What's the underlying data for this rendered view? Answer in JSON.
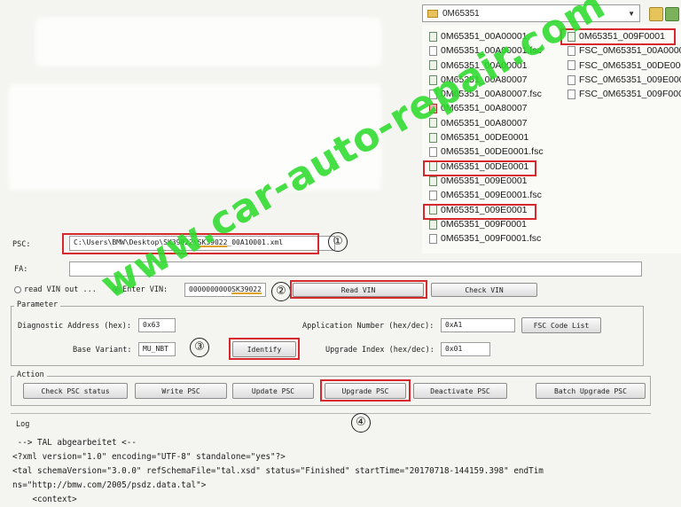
{
  "file_browser": {
    "folder": "0M65351",
    "col1": [
      {
        "name": "0M65351_00A00001",
        "type": "xml"
      },
      {
        "name": "0M65351_00A00001.fsc",
        "type": "file"
      },
      {
        "name": "0M65351_00A00001",
        "type": "xml"
      },
      {
        "name": "0M65351_00A80007",
        "type": "xml"
      },
      {
        "name": "0M65351_00A80007.fsc",
        "type": "file"
      },
      {
        "name": "0M65351_00A80007",
        "type": "exe"
      },
      {
        "name": "0M65351_00A80007",
        "type": "xml"
      },
      {
        "name": "0M65351_00DE0001",
        "type": "xml"
      },
      {
        "name": "0M65351_00DE0001.fsc",
        "type": "file"
      },
      {
        "name": "0M65351_00DE0001",
        "type": "xml"
      },
      {
        "name": "0M65351_009E0001",
        "type": "xml"
      },
      {
        "name": "0M65351_009E0001.fsc",
        "type": "file"
      },
      {
        "name": "0M65351_009E0001",
        "type": "xml"
      },
      {
        "name": "0M65351_009F0001",
        "type": "xml"
      },
      {
        "name": "0M65351_009F0001.fsc",
        "type": "file"
      }
    ],
    "col2": [
      {
        "name": "0M65351_009F0001",
        "type": "xml"
      },
      {
        "name": "FSC_0M65351_00A0000",
        "type": "file"
      },
      {
        "name": "FSC_0M65351_00DE000",
        "type": "file"
      },
      {
        "name": "FSC_0M65351_009E000",
        "type": "file"
      },
      {
        "name": "FSC_0M65351_009F000",
        "type": "file"
      }
    ]
  },
  "form": {
    "psc_label": "PSC:",
    "psc_value_pre": "C:\\Users\\BMW\\Desktop\\SK39022\\",
    "psc_value_hl": "SK39022",
    "psc_value_post": "_00A10001.xml",
    "fa_label": "FA:",
    "fa_value": "",
    "radio_read_vin": "read VIN out ...",
    "radio_enter_vin": "Enter VIN:",
    "vin_pre": "0000000000",
    "vin_hl": "SK39022",
    "read_vin_button": "Read VIN",
    "check_vin_button": "Check VIN"
  },
  "parameter": {
    "title": "Parameter",
    "diag_label": "Diagnostic Address (hex):",
    "diag_value": "0x63",
    "app_label": "Application Number (hex/dec):",
    "app_value": "0xA1",
    "fsc_code_list_button": "FSC Code List",
    "base_variant_label": "Base Variant:",
    "base_variant_value": "MU_NBT",
    "identify_button": "Identify",
    "upgrade_index_label": "Upgrade Index (hex/dec):",
    "upgrade_index_value": "0x01"
  },
  "action": {
    "title": "Action",
    "check_button": "Check PSC status",
    "write_button": "Write PSC",
    "update_button": "Update PSC",
    "upgrade_button": "Upgrade PSC",
    "deactivate_button": "Deactivate PSC",
    "batch_button": "Batch Upgrade PSC"
  },
  "log": {
    "title": "Log",
    "lines": [
      " --> TAL abgearbeitet <--",
      "<?xml version=\"1.0\" encoding=\"UTF-8\" standalone=\"yes\"?>",
      "<tal schemaVersion=\"3.0.0\" refSchemaFile=\"tal.xsd\" status=\"Finished\" startTime=\"20170718-144159.398\" endTim",
      "ns=\"http://bmw.com/2005/psdz.data.tal\">",
      "    <context>"
    ]
  },
  "annotations": {
    "step1": "①",
    "step2": "②",
    "step3": "③",
    "step4": "④"
  },
  "watermark": "www.car-auto-repair.com",
  "colors": {
    "highlight_red": "#d8282e",
    "watermark_green": "#2ddc2d",
    "underline_orange": "#e0a020"
  }
}
